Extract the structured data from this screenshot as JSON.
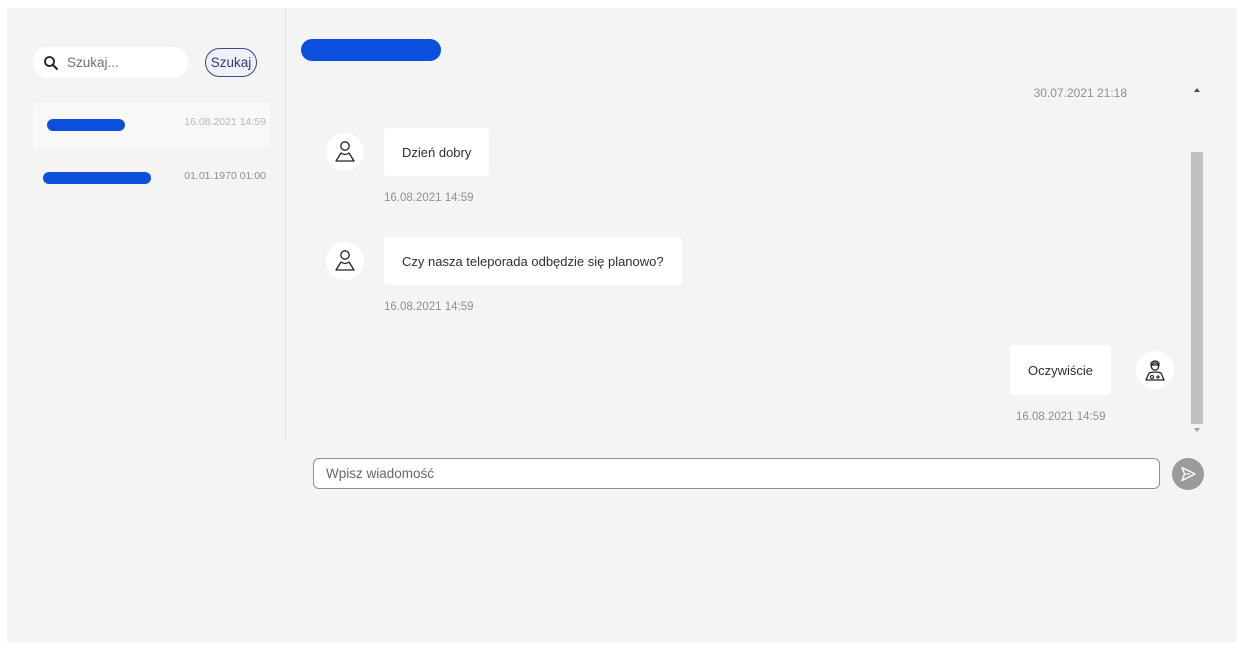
{
  "sidebar": {
    "search": {
      "placeholder": "Szukaj...",
      "button_label": "Szukaj"
    },
    "conversations": [
      {
        "date": "16.08.2021 14:59",
        "active": true
      },
      {
        "date": "01.01.1970 01:00",
        "active": false
      }
    ]
  },
  "chat": {
    "top_date": "30.07.2021 21:18",
    "messages": [
      {
        "side": "left",
        "avatar": "user-icon",
        "text": "Dzień dobry",
        "time": "16.08.2021 14:59"
      },
      {
        "side": "left",
        "avatar": "user-icon",
        "text": "Czy nasza teleporada odbędzie się planowo?",
        "time": "16.08.2021 14:59"
      },
      {
        "side": "right",
        "avatar": "doctor-icon",
        "text": "Oczywiście",
        "time": "16.08.2021 14:59"
      }
    ]
  },
  "composer": {
    "placeholder": "Wpisz wiadomość",
    "send_icon": "send-icon"
  },
  "colors": {
    "accent_blue": "#0b4fdc",
    "button_border": "#3c4a8c",
    "panel_bg": "#f4f4f5"
  }
}
